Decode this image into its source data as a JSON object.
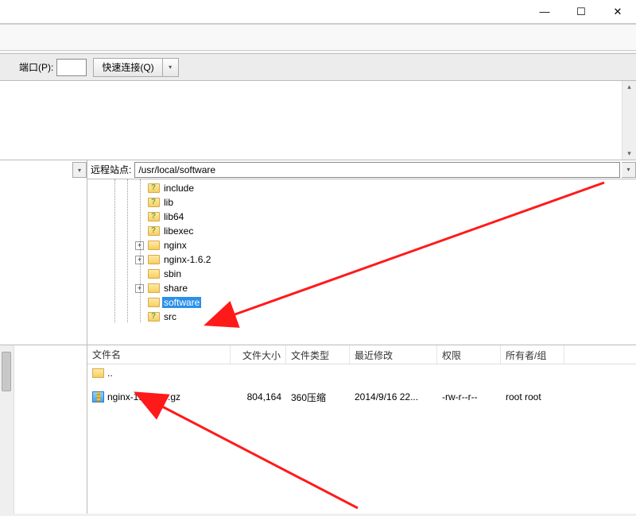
{
  "titlebar": {
    "min": "—",
    "max": "☐",
    "close": "✕"
  },
  "connect": {
    "port_label": "端口(P):",
    "port_value": "",
    "quick_connect": "快速连接(Q)",
    "drop_glyph": "▾"
  },
  "remote": {
    "label": "远程站点:",
    "path": "/usr/local/software",
    "tree": [
      {
        "indent": 60,
        "exp": "",
        "iconq": true,
        "name": "include",
        "sel": false
      },
      {
        "indent": 60,
        "exp": "",
        "iconq": true,
        "name": "lib",
        "sel": false
      },
      {
        "indent": 60,
        "exp": "",
        "iconq": true,
        "name": "lib64",
        "sel": false
      },
      {
        "indent": 60,
        "exp": "",
        "iconq": true,
        "name": "libexec",
        "sel": false
      },
      {
        "indent": 60,
        "exp": "+",
        "iconq": false,
        "name": "nginx",
        "sel": false
      },
      {
        "indent": 60,
        "exp": "+",
        "iconq": false,
        "name": "nginx-1.6.2",
        "sel": false
      },
      {
        "indent": 60,
        "exp": "",
        "iconq": false,
        "name": "sbin",
        "sel": false
      },
      {
        "indent": 60,
        "exp": "+",
        "iconq": false,
        "name": "share",
        "sel": false
      },
      {
        "indent": 60,
        "exp": "",
        "iconq": false,
        "name": "software",
        "sel": true
      },
      {
        "indent": 60,
        "exp": "",
        "iconq": true,
        "name": "src",
        "sel": false
      }
    ]
  },
  "filelist": {
    "headers": {
      "name": "文件名",
      "size": "文件大小",
      "type": "文件类型",
      "mod": "最近修改",
      "perm": "权限",
      "own": "所有者/组"
    },
    "up": "..",
    "rows": [
      {
        "name": "nginx-1.6.2.tar.gz",
        "size": "804,164",
        "type": "360压缩",
        "mod": "2014/9/16 22...",
        "perm": "-rw-r--r--",
        "own": "root root"
      }
    ]
  }
}
